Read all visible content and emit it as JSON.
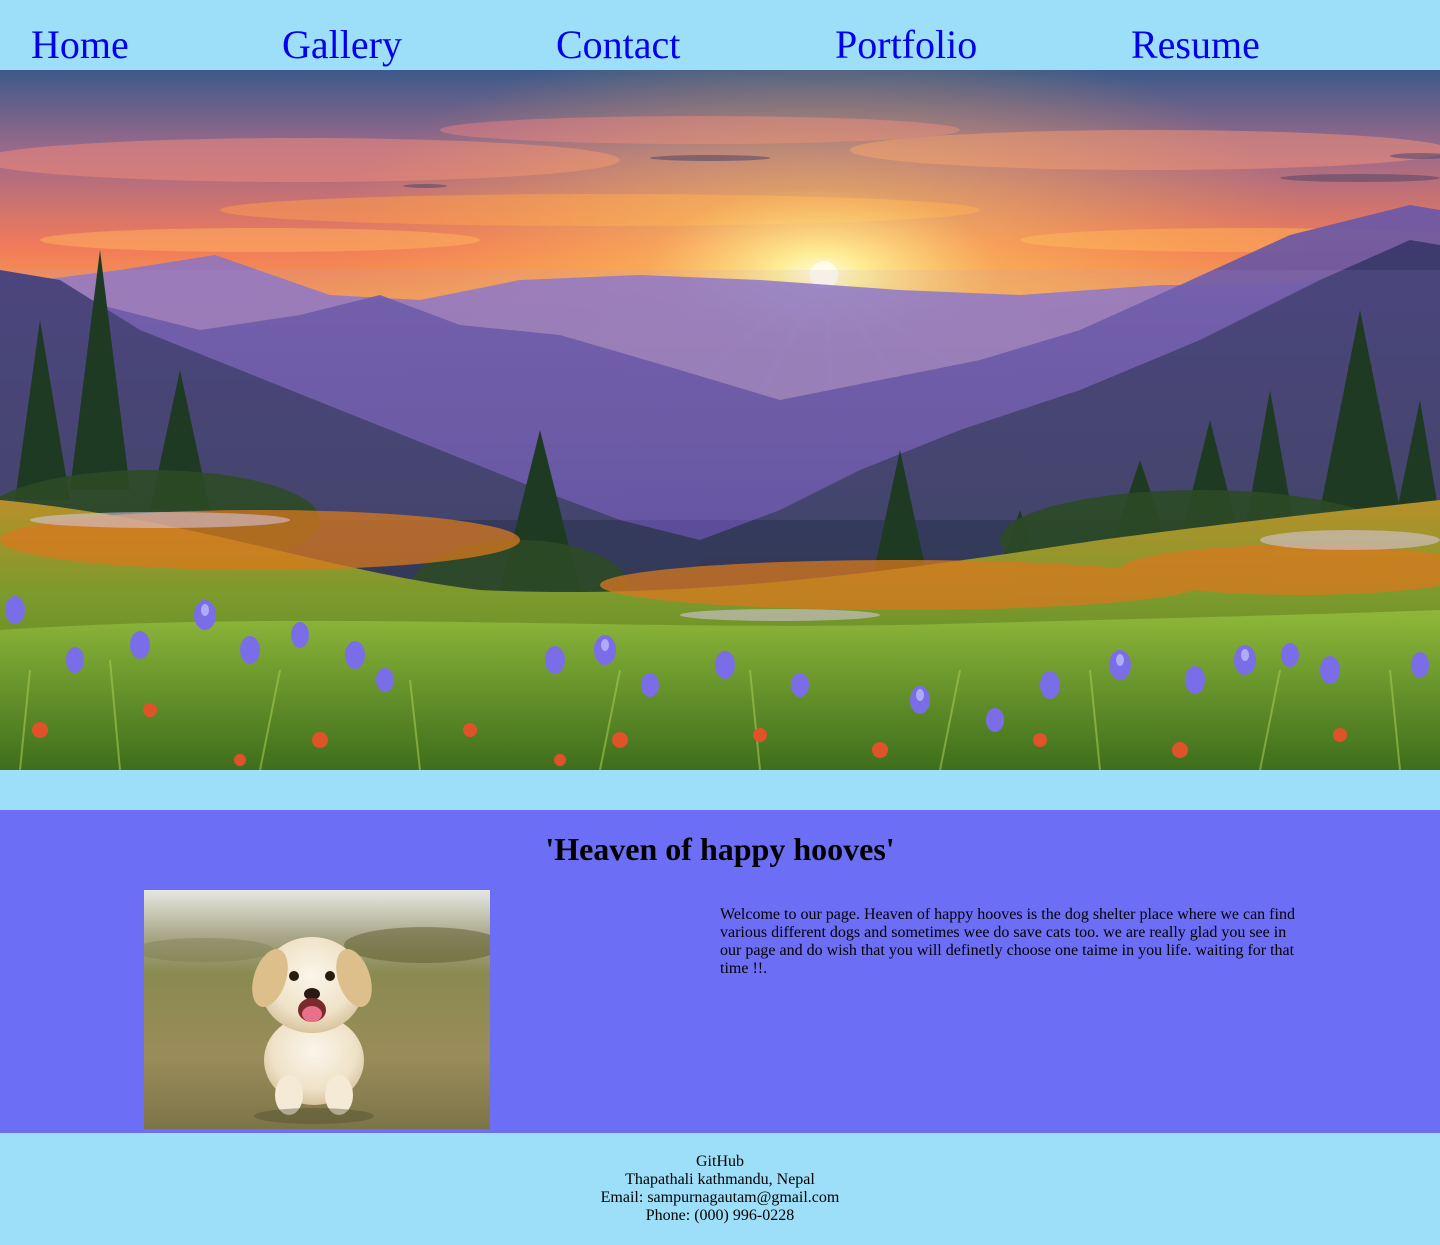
{
  "nav": {
    "items": [
      {
        "label": "Home"
      },
      {
        "label": "Gallery"
      },
      {
        "label": "Contact"
      },
      {
        "label": "Portfolio"
      },
      {
        "label": "Resume"
      }
    ]
  },
  "main": {
    "title": "'Heaven of happy hooves'",
    "welcome_text": "Welcome to our page. Heaven of happy hooves is the dog shelter place where we can find various different dogs and sometimes wee do save cats too. we are really glad you see in our page and do wish that you will definetly choose one taime in you life. waiting for that time !!."
  },
  "footer": {
    "github": "GitHub",
    "address": "Thapathali kathmandu, Nepal",
    "email": "Email: sampurnagautam@gmail.com",
    "phone": "Phone: (000) 996-0228"
  },
  "colors": {
    "nav_bg": "#9ddff8",
    "link": "#0000ee",
    "main_bg": "#6c6ff5"
  }
}
